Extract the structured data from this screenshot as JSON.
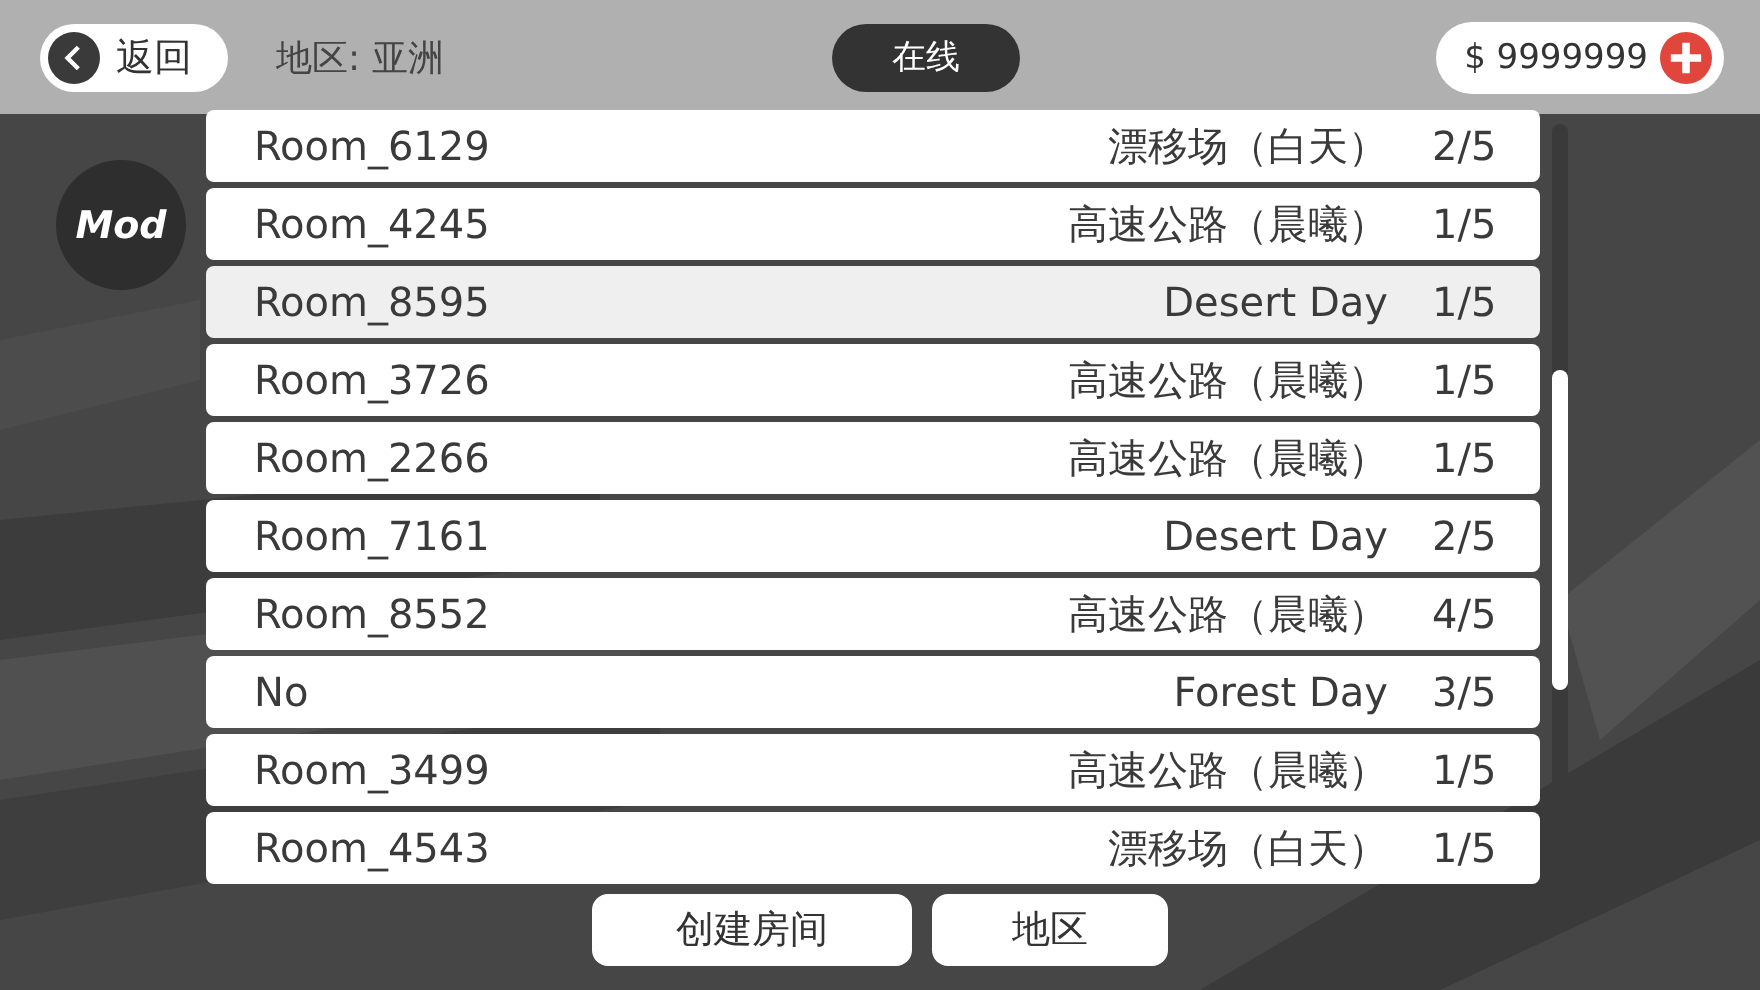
{
  "top_bar": {
    "back_button": "返回",
    "region_label": "地区: 亚洲",
    "mode_tab": "在线",
    "money": "$ 9999999"
  },
  "mod_badge": "Mod",
  "rooms": [
    {
      "name": "Room_6129",
      "map": "漂移场（白天）",
      "players": "2/5",
      "selected": false
    },
    {
      "name": "Room_4245",
      "map": "高速公路（晨曦）",
      "players": "1/5",
      "selected": false
    },
    {
      "name": "Room_8595",
      "map": "Desert Day",
      "players": "1/5",
      "selected": true
    },
    {
      "name": "Room_3726",
      "map": "高速公路（晨曦）",
      "players": "1/5",
      "selected": false
    },
    {
      "name": "Room_2266",
      "map": "高速公路（晨曦）",
      "players": "1/5",
      "selected": false
    },
    {
      "name": "Room_7161",
      "map": "Desert Day",
      "players": "2/5",
      "selected": false
    },
    {
      "name": "Room_8552",
      "map": "高速公路（晨曦）",
      "players": "4/5",
      "selected": false
    },
    {
      "name": "No",
      "map": "Forest Day",
      "players": "3/5",
      "selected": false
    },
    {
      "name": "Room_3499",
      "map": "高速公路（晨曦）",
      "players": "1/5",
      "selected": false
    },
    {
      "name": "Room_4543",
      "map": "漂移场（白天）",
      "players": "1/5",
      "selected": false
    }
  ],
  "buttons": [
    "创建房间",
    "地区"
  ]
}
